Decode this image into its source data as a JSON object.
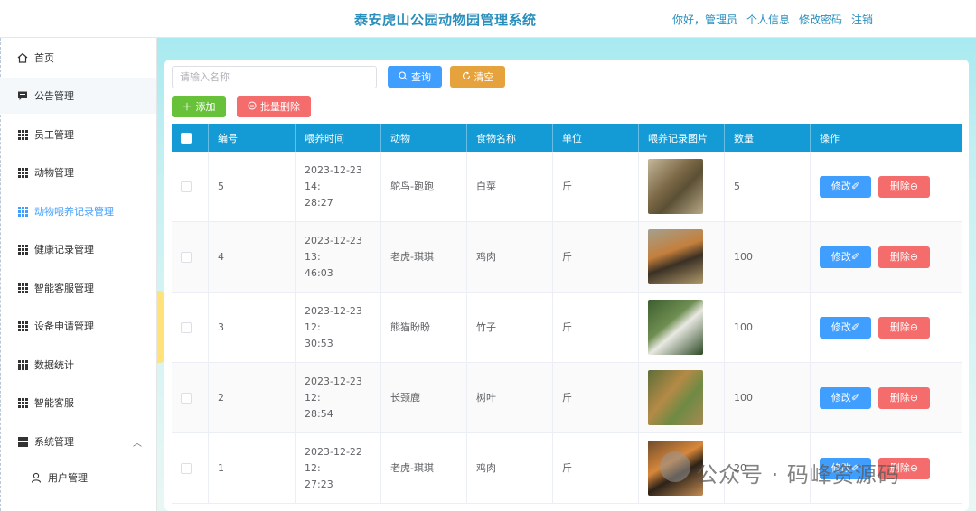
{
  "header": {
    "title": "泰安虎山公园动物园管理系统",
    "greeting": "你好，管理员",
    "profile": "个人信息",
    "change_password": "修改密码",
    "logout": "注销"
  },
  "sidebar": {
    "items": [
      {
        "label": "首页",
        "icon": "home-icon"
      },
      {
        "label": "公告管理",
        "icon": "message-icon"
      },
      {
        "label": "员工管理",
        "icon": "grid-icon"
      },
      {
        "label": "动物管理",
        "icon": "grid-icon"
      },
      {
        "label": "动物喂养记录管理",
        "icon": "grid-icon",
        "active": true
      },
      {
        "label": "健康记录管理",
        "icon": "grid-icon"
      },
      {
        "label": "智能客服管理",
        "icon": "grid-icon"
      },
      {
        "label": "设备申请管理",
        "icon": "grid-icon"
      },
      {
        "label": "数据统计",
        "icon": "grid-icon"
      },
      {
        "label": "智能客服",
        "icon": "grid-icon"
      },
      {
        "label": "系统管理",
        "icon": "apps-icon"
      },
      {
        "label": "用户管理",
        "icon": "user-icon"
      }
    ]
  },
  "toolbar": {
    "search_placeholder": "请输入名称",
    "query_label": "查询",
    "clear_label": "清空",
    "add_label": "添加",
    "bulk_delete_label": "批量删除"
  },
  "table": {
    "headers": [
      "编号",
      "喂养时间",
      "动物",
      "食物名称",
      "单位",
      "喂养记录图片",
      "数量",
      "操作"
    ],
    "edit_label": "修改",
    "delete_label": "删除",
    "rows": [
      {
        "id": "5",
        "time1": "2023-12-23 14:",
        "time2": "28:27",
        "animal": "鸵鸟-跑跑",
        "food": "白菜",
        "unit": "斤",
        "qty": "5"
      },
      {
        "id": "4",
        "time1": "2023-12-23 13:",
        "time2": "46:03",
        "animal": "老虎-琪琪",
        "food": "鸡肉",
        "unit": "斤",
        "qty": "100"
      },
      {
        "id": "3",
        "time1": "2023-12-23 12:",
        "time2": "30:53",
        "animal": "熊猫盼盼",
        "food": "竹子",
        "unit": "斤",
        "qty": "100"
      },
      {
        "id": "2",
        "time1": "2023-12-23 12:",
        "time2": "28:54",
        "animal": "长颈鹿",
        "food": "树叶",
        "unit": "斤",
        "qty": "100"
      },
      {
        "id": "1",
        "time1": "2023-12-22 12:",
        "time2": "27:23",
        "animal": "老虎-琪琪",
        "food": "鸡肉",
        "unit": "斤",
        "qty": "20"
      }
    ]
  },
  "watermark": "公众号 · 码峰资源码"
}
